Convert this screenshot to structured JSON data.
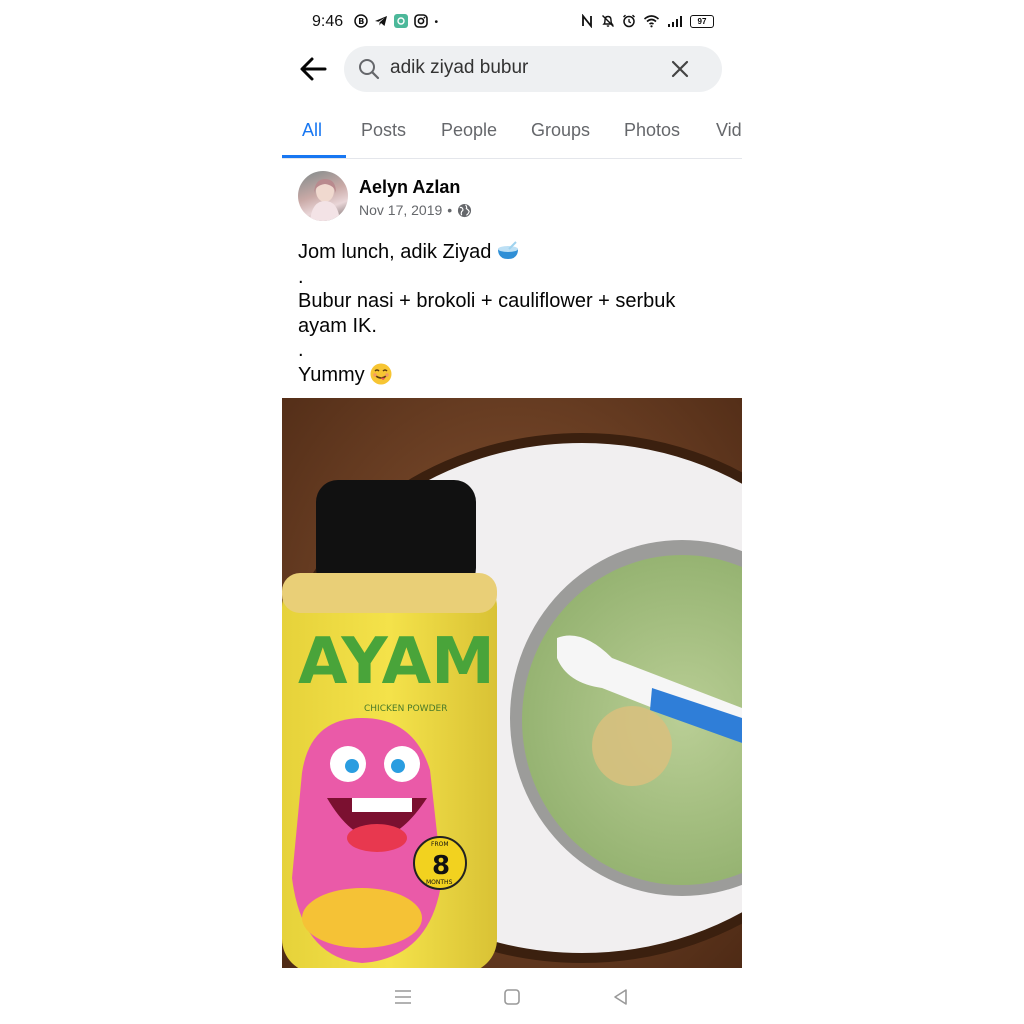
{
  "status_bar": {
    "time": "9:46",
    "battery": "97",
    "left_icons": [
      "b-icon",
      "telegram-icon",
      "app-icon",
      "instagram-icon",
      "dot-icon"
    ],
    "right_icons": [
      "nfc-icon",
      "mute-icon",
      "alarm-icon",
      "wifi-icon",
      "signal-icon",
      "battery-icon"
    ]
  },
  "search": {
    "query": "adik ziyad bubur"
  },
  "tabs": [
    "All",
    "Posts",
    "People",
    "Groups",
    "Photos",
    "Vid"
  ],
  "active_tab": "All",
  "colors": {
    "accent": "#1877f2",
    "search_bg": "#eef0f2",
    "secondary_text": "#65676b"
  },
  "post": {
    "author": "Aelyn Azlan",
    "date": "Nov 17, 2019",
    "separator": "•",
    "audience_icon": "globe-icon",
    "lines": {
      "l1": "Jom lunch, adik Ziyad",
      "l2": ".",
      "l3": "Bubur nasi + brokoli + cauliflower + serbuk ayam IK.",
      "l4": ".",
      "l5": "Yummy"
    },
    "photo": {
      "label_brand": "AYAM",
      "label_sub": "CHICKEN POWDER",
      "badge_from": "FROM",
      "badge_num": "8",
      "badge_unit": "MONTHS"
    }
  },
  "nav": [
    "menu-icon",
    "home-icon",
    "back-triangle-icon"
  ]
}
